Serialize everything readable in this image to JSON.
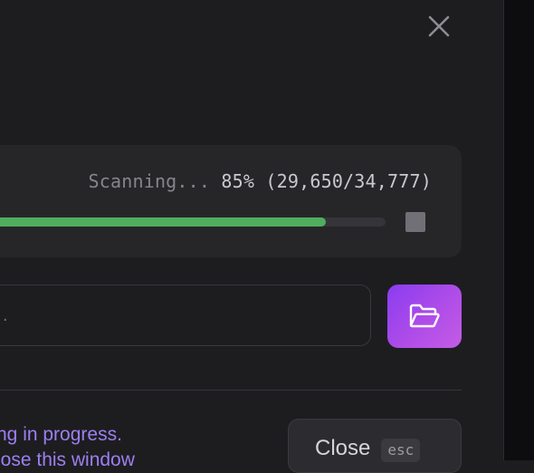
{
  "dialog": {
    "close_icon": "x-icon"
  },
  "scan": {
    "status_prefix": "Scanning... ",
    "percent_text": "85% (29,650/34,777)",
    "progress": 0.85,
    "progress_color": "#4fae5d",
    "stop_icon": "stop-square-icon"
  },
  "path_field": {
    "value": "."
  },
  "folder_button": {
    "icon": "folder-open-icon",
    "accent": "#a347ea"
  },
  "footer": {
    "message_line1": "ng in progress.",
    "message_line2": "lose this window",
    "message_color": "#9d7ff0",
    "close_label": "Close",
    "close_shortcut": "esc"
  }
}
